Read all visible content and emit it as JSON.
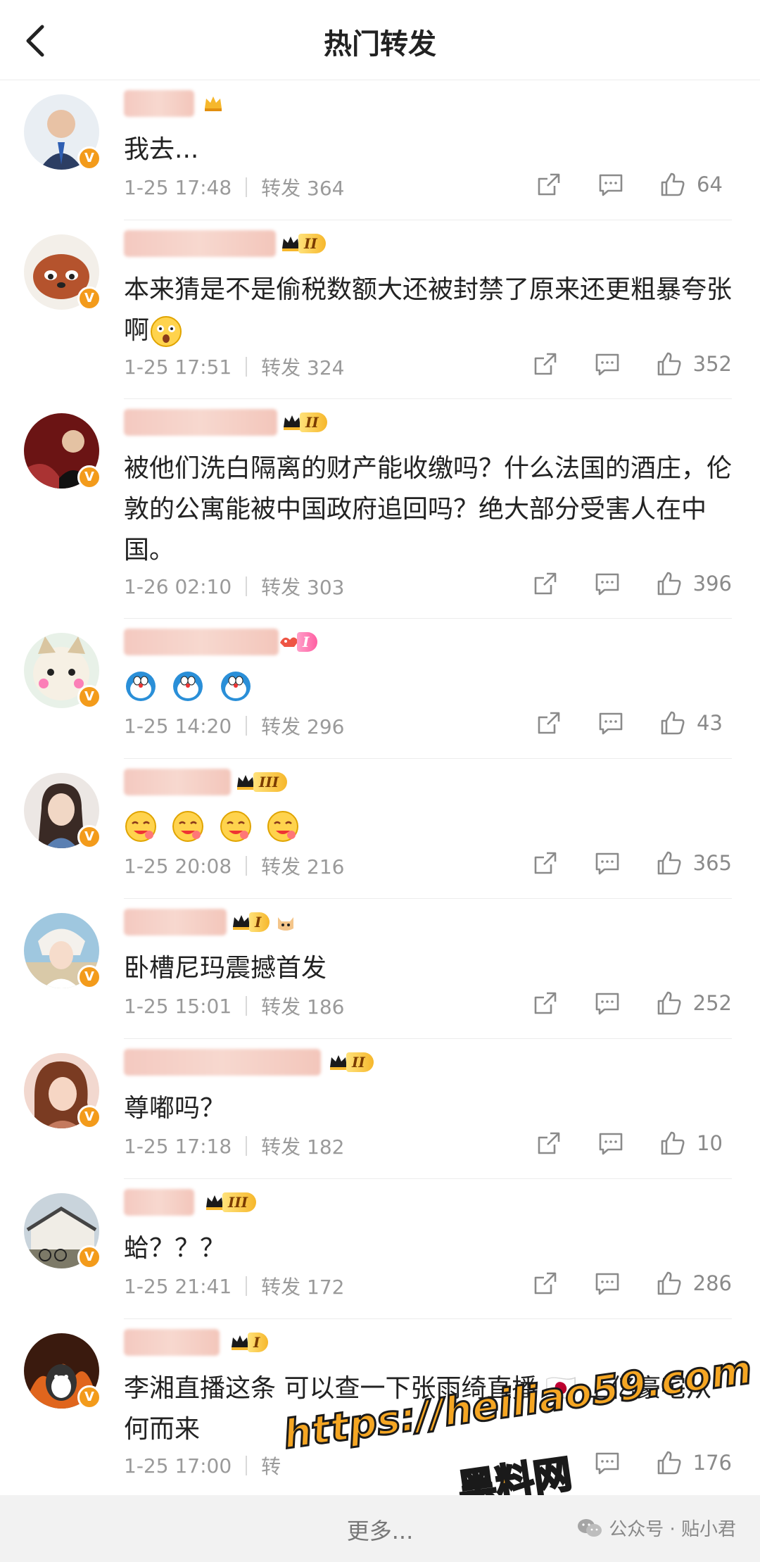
{
  "header": {
    "title": "热门转发"
  },
  "items": [
    {
      "text": "我去...",
      "time": "1-25 17:48",
      "repost": "转发 364",
      "likes": "64",
      "level": "",
      "avatar_color": "#2c3e63"
    },
    {
      "text": "本来猜是不是偷税数额大还被封禁了原来还更粗暴夸张啊",
      "time": "1-25 17:51",
      "repost": "转发 324",
      "likes": "352",
      "level": "II",
      "avatar_color": "#b5532d"
    },
    {
      "text": "被他们洗白隔离的财产能收缴吗？什么法国的酒庄，伦敦的公寓能被中国政府追回吗？绝大部分受害人在中国。",
      "time": "1-26 02:10",
      "repost": "转发 303",
      "likes": "396",
      "level": "II",
      "avatar_color": "#6b1414"
    },
    {
      "text": "",
      "time": "1-25 14:20",
      "repost": "转发 296",
      "likes": "43",
      "level": "I",
      "avatar_color": "#d9c5a0"
    },
    {
      "text": "",
      "time": "1-25 20:08",
      "repost": "转发 216",
      "likes": "365",
      "level": "III",
      "avatar_color": "#cfc6c3"
    },
    {
      "text": "卧槽尼玛震撼首发",
      "time": "1-25 15:01",
      "repost": "转发 186",
      "likes": "252",
      "level": "I",
      "avatar_color": "#9fc7df"
    },
    {
      "text": "尊嘟吗？",
      "time": "1-25 17:18",
      "repost": "转发 182",
      "likes": "10",
      "level": "II",
      "avatar_color": "#c47a5e"
    },
    {
      "text": "蛤？？？",
      "time": "1-25 21:41",
      "repost": "转发 172",
      "likes": "286",
      "level": "III",
      "avatar_color": "#7d7a68"
    },
    {
      "text": "李湘直播这条 可以查一下张雨绮直播 🇯🇵 上亿豪宅从何而来",
      "time": "1-25 17:00",
      "repost": "转",
      "likes": "176",
      "level": "I",
      "avatar_color": "#e0651d"
    }
  ],
  "footer": {
    "more": "更多...",
    "wechat": "公众号 · 贴小君"
  },
  "watermark": {
    "line1": "https://heiliao59.com",
    "line2": "黑料网"
  },
  "verified_mark": "V",
  "colors": {
    "accent": "#f39b1b",
    "meta": "#9a9a9a"
  }
}
